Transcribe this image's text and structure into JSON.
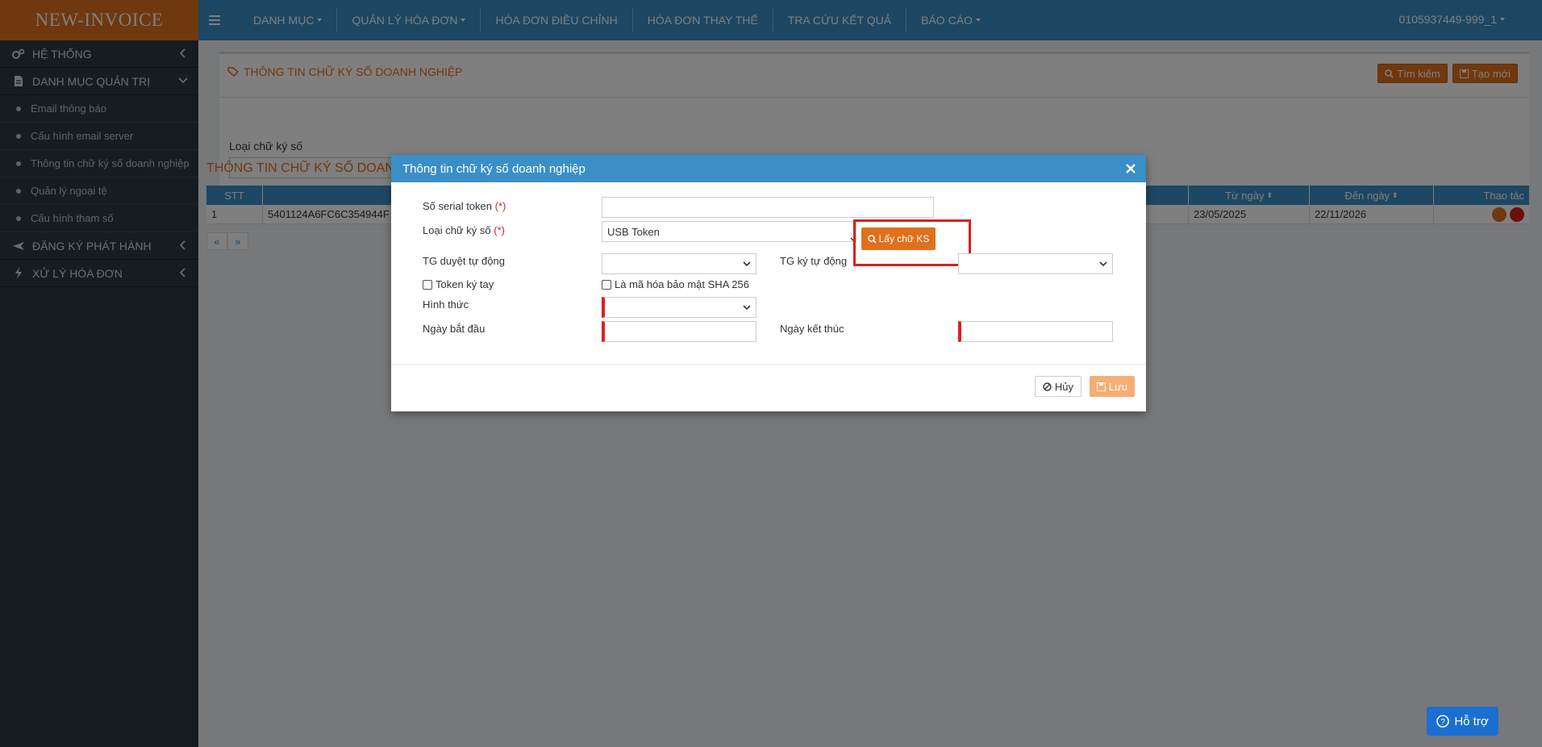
{
  "brand": "NEW-INVOICE",
  "topnav": {
    "items": [
      {
        "label": "DANH MỤC",
        "dropdown": true
      },
      {
        "label": "QUẢN LÝ HÓA ĐƠN",
        "dropdown": true
      },
      {
        "label": "HÓA ĐƠN ĐIỀU CHỈNH",
        "dropdown": false
      },
      {
        "label": "HÓA ĐƠN THAY THẾ",
        "dropdown": false
      },
      {
        "label": "TRA CỨU KẾT QUẢ",
        "dropdown": false
      },
      {
        "label": "BÁO CÁO",
        "dropdown": true
      }
    ],
    "user": "0105937449-999_1"
  },
  "sidebar": {
    "menu_he_thong": "HỆ THỐNG",
    "menu_danh_muc": "DANH MỤC QUẢN TRỊ",
    "sub_items": [
      "Email thông báo",
      "Cấu hình email server",
      "Thông tin chữ ký số doanh nghiệp",
      "Quản lý ngoại tệ",
      "Cấu hình tham số"
    ],
    "menu_dang_ky": "ĐĂNG KÝ PHÁT HÀNH",
    "menu_xu_ly": "XỬ LÝ HÓA ĐƠN"
  },
  "page": {
    "panel_title": "THÔNG TIN CHỮ KÝ SỐ DOANH NGHIỆP",
    "search_btn": "Tìm kiếm",
    "create_btn": "Tạo mới",
    "filter_label": "Loại chữ ký số",
    "list_title": "THÔNG TIN CHỮ KÝ SỐ DOANH",
    "table": {
      "headers": {
        "stt": "STT",
        "tu_ngay": "Từ ngày",
        "den_ngay": "Đến ngày",
        "thao_tac": "Thao tác"
      },
      "rows": [
        {
          "stt": "1",
          "serial": "5401124A6FC6C354944F",
          "tu_ngay": "23/05/2025",
          "den_ngay": "22/11/2026"
        }
      ]
    },
    "pager_prev": "«",
    "pager_next": "»"
  },
  "modal": {
    "title": "Thông tin chữ ký số doanh nghiệp",
    "serial_label": "Số serial token",
    "required_mark": "(*)",
    "type_label": "Loại chữ ký số",
    "type_value": "USB Token",
    "get_sig_btn": "Lấy chữ KS",
    "auto_approve_label": "TG duyệt tự động",
    "auto_sign_label": "TG ký tự động",
    "manual_token_label": "Token ký tay",
    "sha256_label": "Là mã hóa bảo mật SHA 256",
    "form_label": "Hình thức",
    "start_label": "Ngày bắt đầu",
    "end_label": "Ngày kết thúc",
    "cancel_btn": "Hủy",
    "save_btn": "Lưu"
  },
  "help_btn": "Hỗ trợ",
  "colors": {
    "brand": "#e0701c",
    "topbar": "#3a8fc6",
    "sidebar": "#2c3b41",
    "required": "#dd1f1f",
    "help": "#1a6fd0"
  }
}
